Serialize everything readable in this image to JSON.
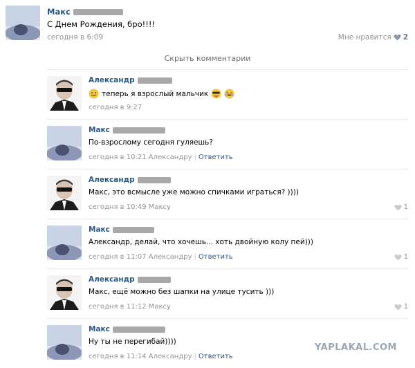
{
  "post": {
    "author": "Макс",
    "text": "С Днем Рождения, бро!!!!",
    "date": "сегодня в 6:09",
    "likes_label": "Мне нравится",
    "likes_count": "2"
  },
  "hide_comments": "Скрыть комментарии",
  "comments": [
    {
      "author": "Александр",
      "text": "теперь я взрослый мальчик",
      "date": "сегодня в 9:27",
      "reply_to": "",
      "reply": "",
      "likes": ""
    },
    {
      "author": "Макс",
      "text": "По-взрослому сегодня гуляешь?",
      "date": "сегодня в 10:21 Александру",
      "reply_to": "",
      "reply": "Ответить",
      "likes": ""
    },
    {
      "author": "Александр",
      "text": "Макс, это всмысле уже можно спичками играться? ))))",
      "date": "сегодня в 10:49 Максу",
      "reply_to": "",
      "reply": "",
      "likes": "1"
    },
    {
      "author": "Макс",
      "text": "Александр, делай, что хочешь... хоть двойную колу пей)))",
      "date": "сегодня в 11:07 Александру",
      "reply_to": "",
      "reply": "Ответить",
      "likes": "1"
    },
    {
      "author": "Александр",
      "text": "Макс, ещё можно без шапки на улице тусить )))",
      "date": "сегодня в 11:12 Максу",
      "reply_to": "",
      "reply": "",
      "likes": "1"
    },
    {
      "author": "Макс",
      "text": "Ну ты не перегибай))))",
      "date": "сегодня в 11:14 Александру",
      "reply_to": "",
      "reply": "Ответить",
      "likes": ""
    }
  ],
  "watermark": "YAPLAKAL.COM"
}
